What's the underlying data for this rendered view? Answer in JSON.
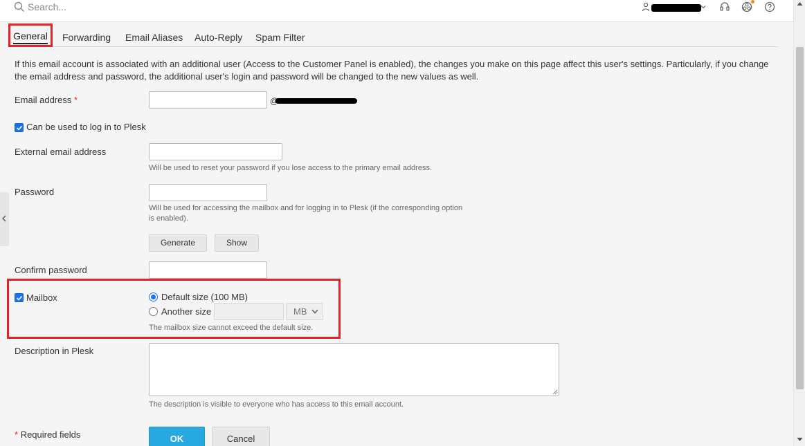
{
  "search": {
    "placeholder": "Search..."
  },
  "header": {
    "icons": [
      "user-icon",
      "chevron-down-icon",
      "support-icon",
      "extensions-icon",
      "help-icon"
    ]
  },
  "tabs": [
    {
      "label": "General",
      "active": true
    },
    {
      "label": "Forwarding",
      "active": false
    },
    {
      "label": "Email Aliases",
      "active": false
    },
    {
      "label": "Auto-Reply",
      "active": false
    },
    {
      "label": "Spam Filter",
      "active": false
    }
  ],
  "info_text": "If this email account is associated with an additional user (Access to the Customer Panel is enabled), the changes you make on this page affect this user's settings. Particularly, if you change the email address and password, the additional user's login and password will be changed to the new values as well.",
  "form": {
    "email_label": "Email address",
    "required_mark": "*",
    "email_value": "",
    "domain_at": "@",
    "login_checkbox_label": "Can be used to log in to Plesk",
    "login_checkbox_checked": true,
    "external_email_label": "External email address",
    "external_email_value": "",
    "external_email_hint": "Will be used to reset your password if you lose access to the primary email address.",
    "password_label": "Password",
    "password_value": "",
    "password_hint": "Will be used for accessing the mailbox and for logging in to Plesk (if the corresponding option is enabled).",
    "generate_label": "Generate",
    "show_label": "Show",
    "confirm_password_label": "Confirm password",
    "confirm_password_value": "",
    "mailbox_label": "Mailbox",
    "mailbox_checked": true,
    "default_size_label": "Default size (100 MB)",
    "another_size_label": "Another size",
    "selected_size_option": "Default size (100 MB)",
    "size_value": "",
    "size_unit": "MB",
    "mailbox_hint": "The mailbox size cannot exceed the default size.",
    "description_label": "Description in Plesk",
    "description_value": "",
    "description_hint": "The description is visible to everyone who has access to this email account.",
    "required_fields_label": "Required fields",
    "ok_label": "OK",
    "cancel_label": "Cancel"
  },
  "colors": {
    "accent_red": "#e41f26",
    "primary_blue": "#28a8e0",
    "checkbox_blue": "#1a73e8"
  }
}
